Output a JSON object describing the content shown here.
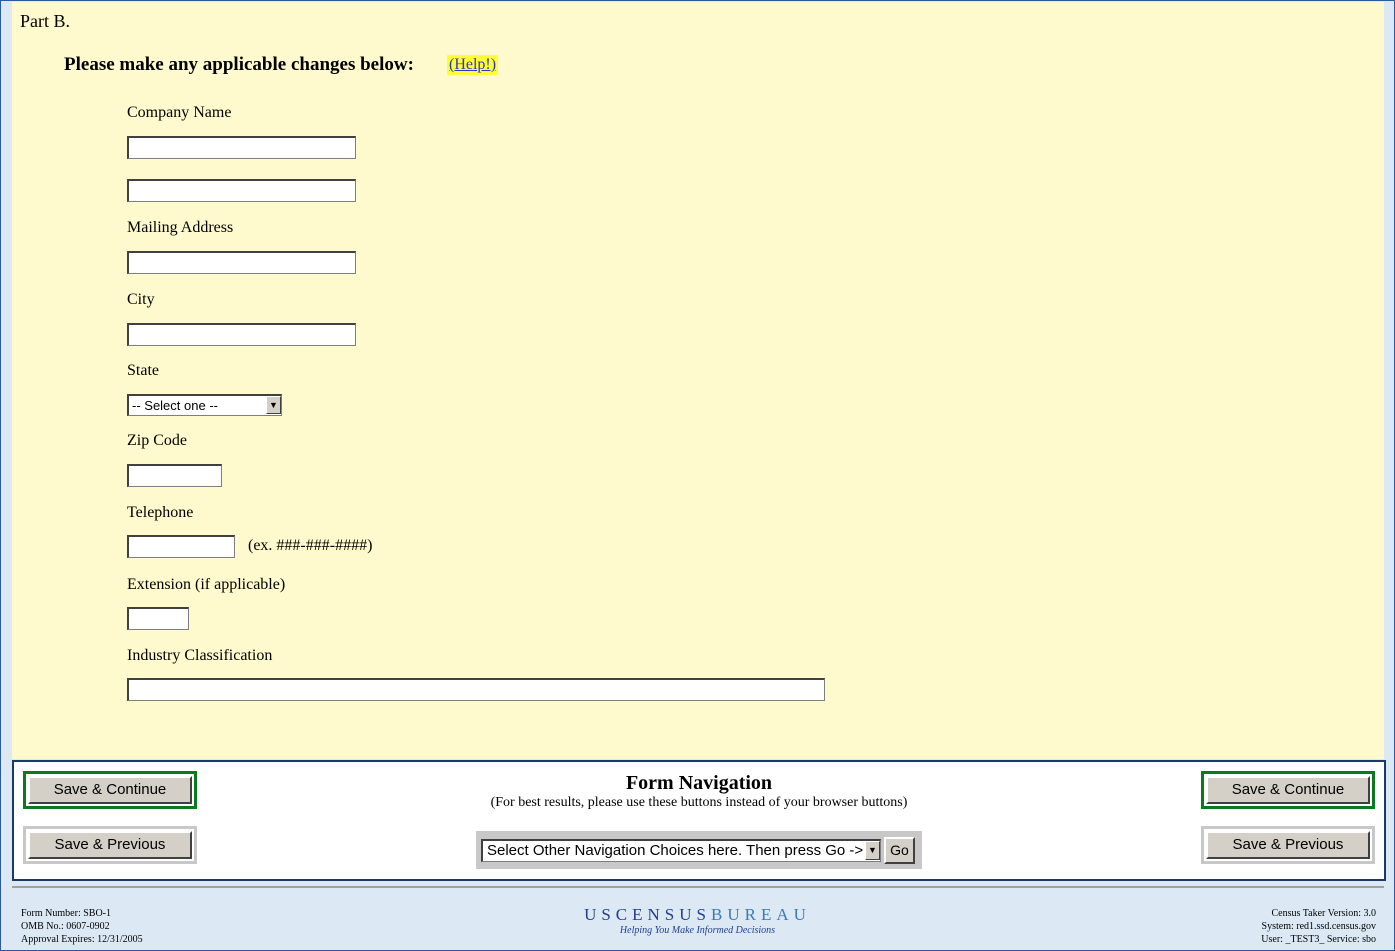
{
  "part": {
    "title": "Part B."
  },
  "instructions": {
    "text": "Please make any applicable changes below:",
    "help_label": "(Help!)"
  },
  "fields": {
    "company_name_label": "Company Name",
    "mailing_address_label": "Mailing Address",
    "city_label": "City",
    "state_label": "State",
    "state_selected": "-- Select one --",
    "zip_label": "Zip Code",
    "telephone_label": "Telephone",
    "telephone_hint": "(ex. ###-###-####)",
    "extension_label": "Extension (if applicable)",
    "industry_label": "Industry Classification"
  },
  "navigation": {
    "title": "Form Navigation",
    "subtitle": "(For best results, please use these buttons instead of your browser buttons)",
    "save_continue": "Save & Continue",
    "save_previous": "Save & Previous",
    "select_placeholder": "Select Other Navigation Choices here. Then press Go ->",
    "go_label": "Go"
  },
  "footer": {
    "form_number": "Form Number: SBO-1",
    "omb": "OMB No.: 0607-0902",
    "approval": "Approval Expires: 12/31/2005",
    "logo_text_a": "USCENSUS",
    "logo_text_b": "BUREAU",
    "logo_tagline": "Helping You Make Informed Decisions",
    "version": "Census Taker Version: 3.0",
    "system": "System: red1.ssd.census.gov",
    "user": "User: _TEST3_   Service: sbo"
  },
  "colors": {
    "form_bg": "#fffacd",
    "nav_border": "#1a3b6a",
    "primary_button_border": "#0a7a1f",
    "help_bg": "#ffff33"
  }
}
